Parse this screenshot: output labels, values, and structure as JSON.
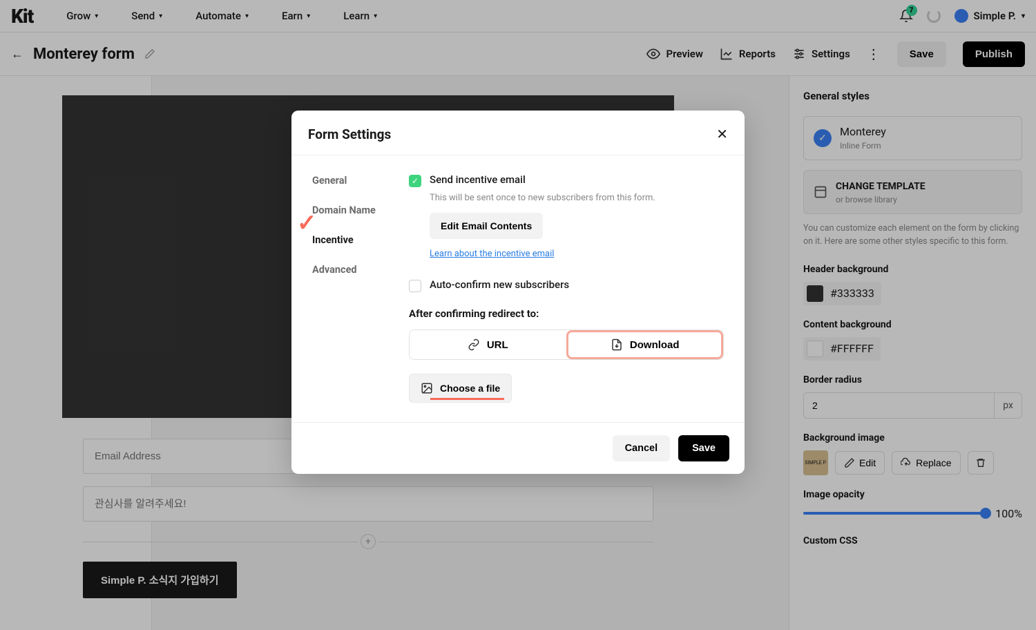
{
  "brand": "Kit",
  "nav": {
    "items": [
      "Grow",
      "Send",
      "Automate",
      "Earn",
      "Learn"
    ],
    "badge": "7",
    "user": "Simple P."
  },
  "subbar": {
    "formName": "Monterey form",
    "preview": "Preview",
    "reports": "Reports",
    "settings": "Settings",
    "save": "Save",
    "publish": "Publish"
  },
  "canvas": {
    "emailPlaceholder": "Email Address",
    "interestPlaceholder": "관심사를 알려주세요!",
    "cta": "Simple P. 소식지 가입하기"
  },
  "panel": {
    "title": "General styles",
    "templateName": "Monterey",
    "templateType": "Inline Form",
    "changeTemplate": "CHANGE TEMPLATE",
    "browse": "or browse library",
    "help": "You can customize each element on the form by clicking on it. Here are some other styles specific to this form.",
    "headerBg": {
      "label": "Header background",
      "value": "#333333"
    },
    "contentBg": {
      "label": "Content background",
      "value": "#FFFFFF"
    },
    "radius": {
      "label": "Border radius",
      "value": "2",
      "unit": "px"
    },
    "bgImage": {
      "label": "Background image",
      "edit": "Edit",
      "replace": "Replace"
    },
    "opacity": {
      "label": "Image opacity",
      "value": "100%"
    },
    "customCss": "Custom CSS"
  },
  "modal": {
    "title": "Form Settings",
    "tabs": {
      "general": "General",
      "domain": "Domain Name",
      "incentive": "Incentive",
      "advanced": "Advanced"
    },
    "incentive": {
      "sendLabel": "Send incentive email",
      "helper": "This will be sent once to new subscribers from this form.",
      "editBtn": "Edit Email Contents",
      "learn": "Learn about the incentive email",
      "autoConfirm": "Auto-confirm new subscribers",
      "redirectHead": "After confirming redirect to:",
      "url": "URL",
      "download": "Download",
      "chooseFile": "Choose a file"
    },
    "footer": {
      "cancel": "Cancel",
      "save": "Save"
    }
  }
}
